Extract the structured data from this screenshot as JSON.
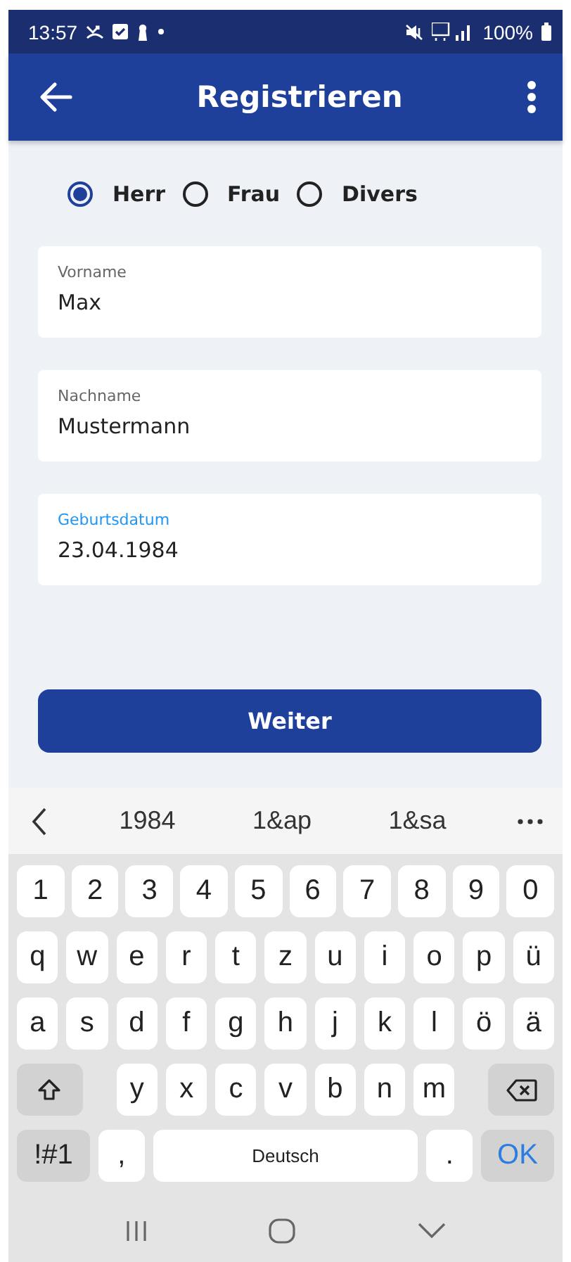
{
  "status_bar": {
    "time": "13:57",
    "battery": "100%"
  },
  "app_bar": {
    "title": "Registrieren"
  },
  "gender_options": [
    {
      "label": "Herr",
      "selected": true
    },
    {
      "label": "Frau",
      "selected": false
    },
    {
      "label": "Divers",
      "selected": false
    }
  ],
  "fields": [
    {
      "label": "Vorname",
      "value": "Max",
      "focused": false
    },
    {
      "label": "Nachname",
      "value": "Mustermann",
      "focused": false
    },
    {
      "label": "Geburtsdatum",
      "value": "23.04.1984",
      "focused": true
    }
  ],
  "submit_button": "Weiter",
  "suggestions": [
    "1984",
    "1&ap",
    "1&sa"
  ],
  "keyboard": {
    "number_keys": [
      {
        "kind": "char",
        "label": "1"
      },
      {
        "kind": "char",
        "label": "2"
      },
      {
        "kind": "char",
        "label": "3"
      },
      {
        "kind": "char",
        "label": "4"
      },
      {
        "kind": "char",
        "label": "5"
      },
      {
        "kind": "char",
        "label": "6"
      },
      {
        "kind": "char",
        "label": "7"
      },
      {
        "kind": "char",
        "label": "8"
      },
      {
        "kind": "char",
        "label": "9"
      },
      {
        "kind": "char",
        "label": "0"
      }
    ],
    "letter_keys_upper": [
      {
        "kind": "char",
        "label": "q"
      },
      {
        "kind": "char",
        "label": "w"
      },
      {
        "kind": "char",
        "label": "e"
      },
      {
        "kind": "char",
        "label": "r"
      },
      {
        "kind": "char",
        "label": "t"
      },
      {
        "kind": "char",
        "label": "z"
      },
      {
        "kind": "char",
        "label": "u"
      },
      {
        "kind": "char",
        "label": "i"
      },
      {
        "kind": "char",
        "label": "o"
      },
      {
        "kind": "char",
        "label": "p"
      },
      {
        "kind": "char",
        "label": "ü"
      }
    ],
    "letter_keys_middle": [
      {
        "kind": "char",
        "label": "a"
      },
      {
        "kind": "char",
        "label": "s"
      },
      {
        "kind": "char",
        "label": "d"
      },
      {
        "kind": "char",
        "label": "f"
      },
      {
        "kind": "char",
        "label": "g"
      },
      {
        "kind": "char",
        "label": "h"
      },
      {
        "kind": "char",
        "label": "j"
      },
      {
        "kind": "char",
        "label": "k"
      },
      {
        "kind": "char",
        "label": "l"
      },
      {
        "kind": "char",
        "label": "ö"
      },
      {
        "kind": "char",
        "label": "ä"
      }
    ],
    "letter_keys_lower": [
      {
        "kind": "shift"
      },
      {
        "kind": "char",
        "label": "y"
      },
      {
        "kind": "char",
        "label": "x"
      },
      {
        "kind": "char",
        "label": "c"
      },
      {
        "kind": "char",
        "label": "v"
      },
      {
        "kind": "char",
        "label": "b"
      },
      {
        "kind": "char",
        "label": "n"
      },
      {
        "kind": "char",
        "label": "m"
      },
      {
        "kind": "backspace"
      }
    ],
    "function_keys": [
      {
        "kind": "symbols",
        "label": "!#1"
      },
      {
        "kind": "char",
        "label": ","
      },
      {
        "kind": "space",
        "label": "Deutsch"
      },
      {
        "kind": "char",
        "label": "."
      },
      {
        "kind": "ok",
        "label": "OK"
      }
    ]
  }
}
